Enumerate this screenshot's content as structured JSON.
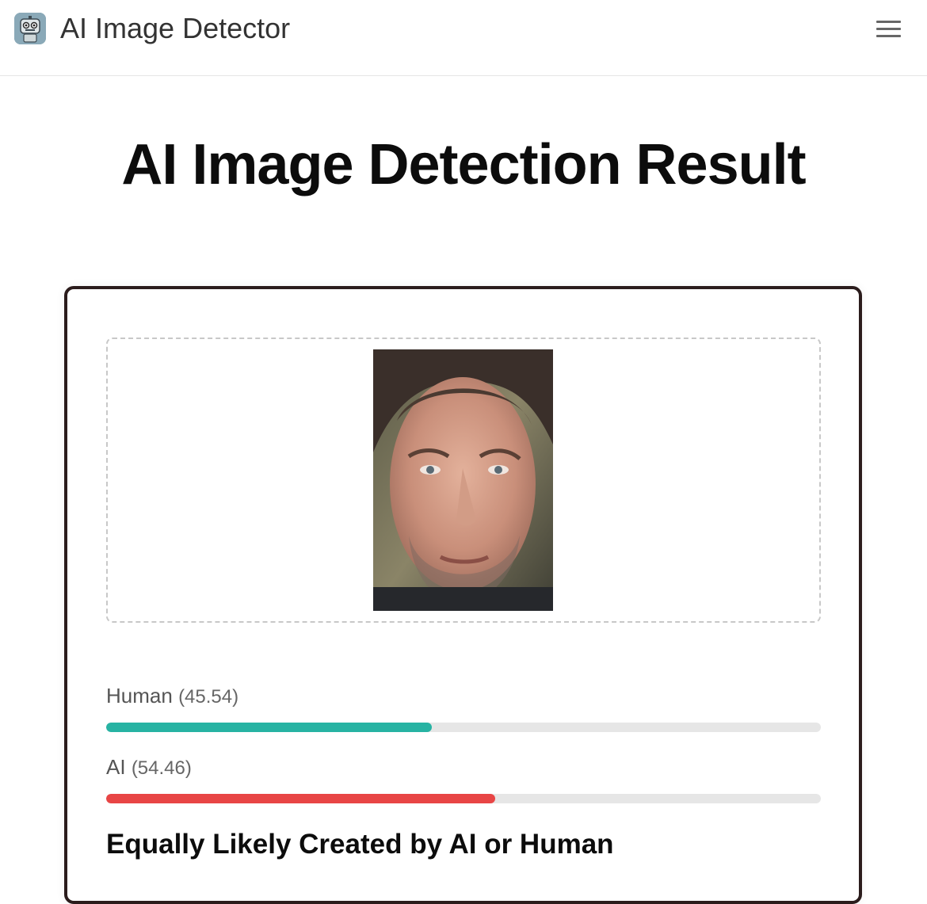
{
  "header": {
    "brand": "AI Image Detector",
    "logo_icon": "robot-icon",
    "menu_icon": "hamburger-menu-icon"
  },
  "main": {
    "title": "AI Image Detection Result",
    "image_icon": "uploaded-face-photo",
    "scores": [
      {
        "label": "Human",
        "value_text": "(45.54)",
        "value": 45.54,
        "color": "#27b3a3"
      },
      {
        "label": "AI",
        "value_text": "(54.46)",
        "value": 54.46,
        "color": "#e84545"
      }
    ],
    "verdict": "Equally Likely Created by AI or Human"
  },
  "colors": {
    "track": "#e6e6e6",
    "card_border": "#2b1c1c",
    "text": "#111111"
  }
}
